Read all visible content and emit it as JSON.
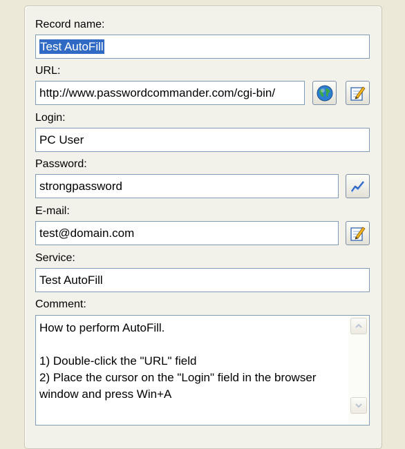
{
  "form": {
    "record_name": {
      "label": "Record name:",
      "value": "Test AutoFill"
    },
    "url": {
      "label": "URL:",
      "value": "http://www.passwordcommander.com/cgi-bin/"
    },
    "login": {
      "label": "Login:",
      "value": "PC User"
    },
    "password": {
      "label": "Password:",
      "value": "strongpassword"
    },
    "email": {
      "label": "E-mail:",
      "value": "test@domain.com"
    },
    "service": {
      "label": "Service:",
      "value": "Test AutoFill"
    },
    "comment": {
      "label": "Comment:",
      "value": "How to perform AutoFill.\n\n1) Double-click the \"URL\" field\n2) Place the cursor on the \"Login\" field in the browser window and press Win+A"
    }
  },
  "icons": {
    "open_url": "globe-icon",
    "edit_url": "edit-icon",
    "password_generator": "password-generator-icon",
    "edit_email": "edit-icon",
    "scroll_up": "scroll-up-arrow-icon",
    "scroll_down": "scroll-down-arrow-icon"
  },
  "colors": {
    "window_bg": "#ece9d8",
    "field_border": "#7f9db9",
    "selection": "#316ac5"
  }
}
